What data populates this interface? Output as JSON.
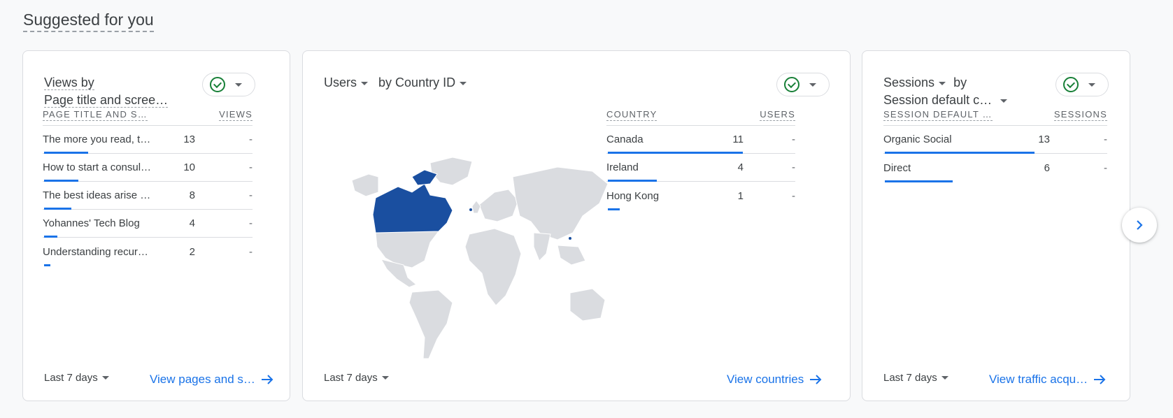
{
  "section_title": "Suggested for you",
  "cards": [
    {
      "title_line1": "Views by",
      "title_line2": "Page title and scree…",
      "col1": "PAGE TITLE AND S…",
      "col2": "VIEWS",
      "rows": [
        {
          "label": "The more you read, t…",
          "value": "13",
          "change": "-",
          "fraction": 0.4
        },
        {
          "label": "How to start a consul…",
          "value": "10",
          "change": "-",
          "fraction": 0.31
        },
        {
          "label": "The best ideas arise …",
          "value": "8",
          "change": "-",
          "fraction": 0.25
        },
        {
          "label": "Yohannes' Tech Blog",
          "value": "4",
          "change": "-",
          "fraction": 0.12
        },
        {
          "label": "Understanding recur…",
          "value": "2",
          "change": "-",
          "fraction": 0.06
        }
      ],
      "date_range": "Last 7 days",
      "link": "View pages and s…"
    },
    {
      "title_metric": "Users",
      "title_dimension": "by Country ID",
      "col1": "COUNTRY",
      "col2": "USERS",
      "rows": [
        {
          "label": "Canada",
          "value": "11",
          "change": "-",
          "fraction": 0.69
        },
        {
          "label": "Ireland",
          "value": "4",
          "change": "-",
          "fraction": 0.25
        },
        {
          "label": "Hong Kong",
          "value": "1",
          "change": "-",
          "fraction": 0.06
        }
      ],
      "date_range": "Last 7 days",
      "link": "View countries"
    },
    {
      "title_line1_metric": "Sessions",
      "title_line1_by": "by",
      "title_line2": "Session default c…",
      "col1": "SESSION DEFAULT …",
      "col2": "SESSIONS",
      "rows": [
        {
          "label": "Organic Social",
          "value": "13",
          "change": "-",
          "fraction": 0.68
        },
        {
          "label": "Direct",
          "value": "6",
          "change": "-",
          "fraction": 0.31
        }
      ],
      "date_range": "Last 7 days",
      "link": "View traffic acqu…"
    }
  ],
  "colors": {
    "accent": "#1a73e8",
    "map_highlight": "#1a4fa0",
    "map_base": "#dadce0",
    "status_ok": "#188038"
  },
  "icons": {
    "status": "check-circle-icon",
    "next": "chevron-right-icon",
    "link_arrow": "arrow-right-icon"
  }
}
